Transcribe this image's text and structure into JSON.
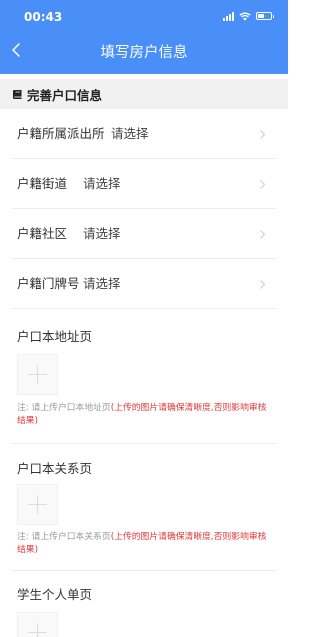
{
  "status_bar": {
    "time": "00:43"
  },
  "nav": {
    "title": "填写房户信息"
  },
  "section": {
    "title": "完善户口信息"
  },
  "rows": [
    {
      "label": "户籍所属派出所",
      "value": "请选择"
    },
    {
      "label": "户籍街道",
      "value": "请选择"
    },
    {
      "label": "户籍社区",
      "value": "请选择"
    },
    {
      "label": "户籍门牌号",
      "value": "请选择"
    }
  ],
  "uploads": [
    {
      "title": "户口本地址页",
      "note_prefix": "注: 请上传户口本地址页",
      "note_warning": "(上传的图片请确保清晰度,否则影响审核结果)"
    },
    {
      "title": "户口本关系页",
      "note_prefix": "注: 请上传户口本关系页",
      "note_warning": "(上传的图片请确保清晰度,否则影响审核结果)"
    },
    {
      "title": "学生个人单页"
    }
  ],
  "colors": {
    "accent": "#4a8ff7",
    "warning": "#e23a3a",
    "hint": "#999999"
  }
}
